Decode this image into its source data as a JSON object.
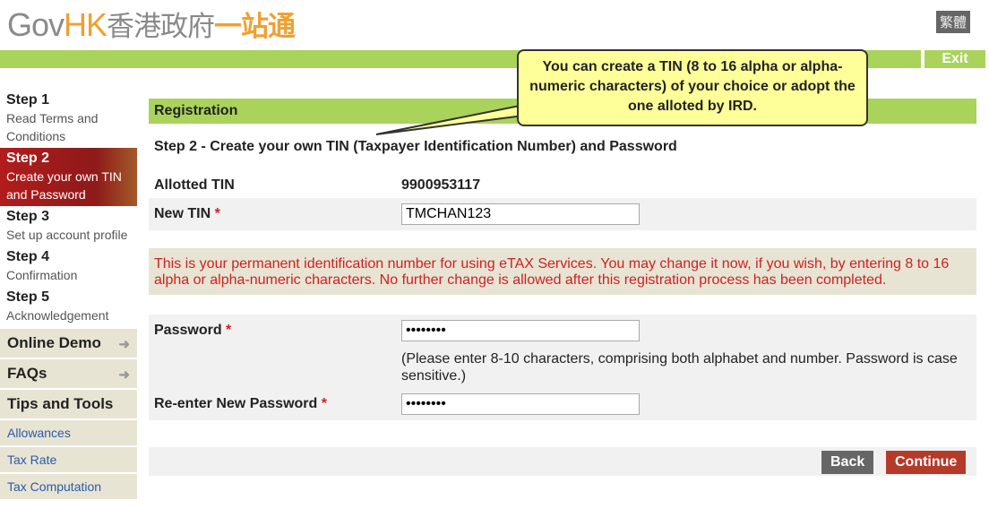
{
  "header": {
    "logo_text": "GovHK香港政府一站通",
    "lang_button": "繁體",
    "exit": "Exit"
  },
  "sidebar": {
    "steps": [
      {
        "title": "Step 1",
        "desc": "Read Terms and Conditions"
      },
      {
        "title": "Step 2",
        "desc": "Create your own TIN and Password"
      },
      {
        "title": "Step 3",
        "desc": "Set up account profile"
      },
      {
        "title": "Step 4",
        "desc": "Confirmation"
      },
      {
        "title": "Step 5",
        "desc": "Acknowledgement"
      }
    ],
    "menus": [
      "Online Demo",
      "FAQs",
      "Tips and Tools"
    ],
    "links": [
      "Allowances",
      "Tax Rate",
      "Tax Computation"
    ]
  },
  "main": {
    "section": "Registration",
    "title": "Step 2 - Create your own TIN (Taxpayer Identification Number) and Password",
    "allotted_tin_label": "Allotted TIN",
    "allotted_tin": "9900953117",
    "new_tin_label": "New TIN",
    "new_tin_value": "TMCHAN123",
    "note": "This is your permanent identification number for using eTAX Services. You may change it now, if you wish, by entering 8 to 16 alpha or alpha-numeric characters. No further change is allowed after this registration process has been completed.",
    "password_label": "Password",
    "password_value": "••••••••",
    "password_hint": "(Please enter 8-10 characters, comprising both alphabet and number. Password is case sensitive.)",
    "reenter_label": "Re-enter New Password",
    "reenter_value": "••••••••",
    "required_mark": "*",
    "back": "Back",
    "continue": "Continue"
  },
  "callout": "You can create a TIN (8 to 16 alpha or alpha-numeric characters) of your choice or adopt the one alloted by IRD."
}
